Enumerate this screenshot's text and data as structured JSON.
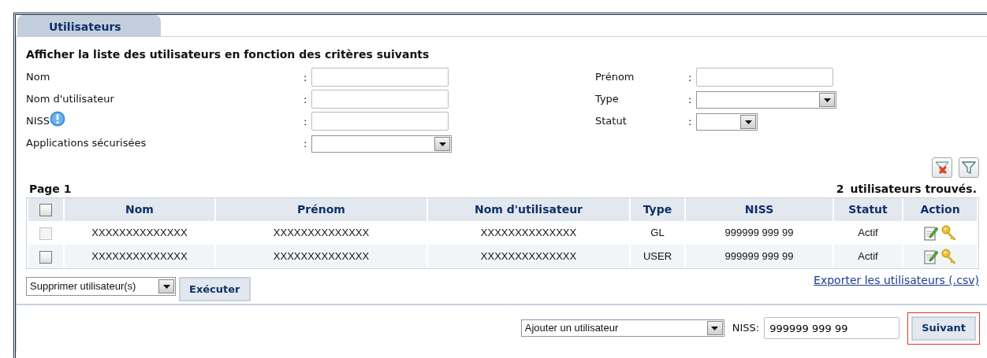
{
  "tabs": [
    {
      "label": "Utilisateurs",
      "selected": true
    }
  ],
  "heading": "Afficher la liste des utilisateurs en fonction des critères suivants",
  "filters_left": [
    {
      "label": "Nom",
      "separator": ":",
      "kind": "text",
      "info": false
    },
    {
      "label": "Nom d'utilisateur",
      "separator": ":",
      "kind": "text",
      "info": false
    },
    {
      "label": "NISS",
      "separator": ":",
      "kind": "text",
      "info": true
    },
    {
      "label": "Applications sécurisées",
      "separator": ":",
      "kind": "select",
      "info": false
    }
  ],
  "filters_right": [
    {
      "label": "Prénom",
      "separator": ":",
      "kind": "text"
    },
    {
      "label": "Type",
      "separator": ":",
      "kind": "select"
    },
    {
      "label": "Statut",
      "separator": ":",
      "kind": "smallselect"
    }
  ],
  "page_label": "Page 1",
  "result_count": "2",
  "result_text": "utilisateurs trouvés.",
  "table": {
    "select_all": {
      "checked": false
    },
    "columns": [
      "Nom",
      "Prénom",
      "Nom d'utilisateur",
      "Type",
      "NISS",
      "Statut",
      "Action"
    ],
    "rows": [
      {
        "disabled": true,
        "checked": false,
        "cells": [
          "XXXXXXXXXXXXXX",
          "XXXXXXXXXXXXXX",
          "XXXXXXXXXXXXXX",
          "GL",
          "999999 999 99",
          "Actif"
        ]
      },
      {
        "disabled": false,
        "checked": false,
        "cells": [
          "XXXXXXXXXXXXXX",
          "XXXXXXXXXXXXXX",
          "XXXXXXXXXXXXXX",
          "USER",
          "999999 999 99",
          "Actif"
        ]
      }
    ]
  },
  "bulk_action": {
    "value": "Supprimer utilisateur(s)",
    "button": "Exécuter"
  },
  "export_link": "Exporter les utilisateurs (.csv)",
  "add_user": {
    "value": "Ajouter un utilisateur",
    "niss_label": "NISS:",
    "niss_value": "999999 999 99",
    "button": "Suivant",
    "highlighted": true
  }
}
